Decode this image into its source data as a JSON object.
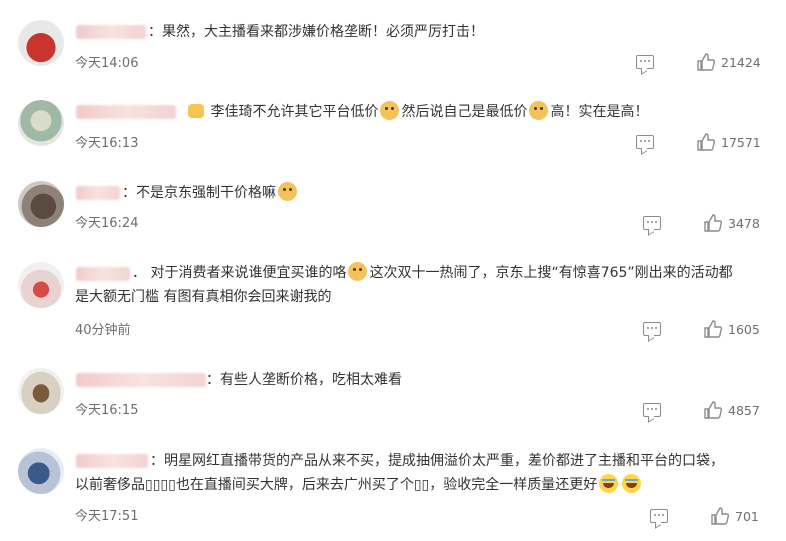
{
  "comments": [
    {
      "separator": "：",
      "segments": [
        "果然，大主播看来都涉嫌价格垄断！必须严厉打击！"
      ],
      "time": "今天14:06",
      "likes": "21424"
    },
    {
      "separator": "",
      "segments": [
        "李佳琦不允许其它平台低价",
        "然后说自己是最低价",
        "高！实在是高！"
      ],
      "time": "今天16:13",
      "likes": "17571"
    },
    {
      "separator": "：",
      "segments": [
        "不是京东强制干价格嘛"
      ],
      "time": "今天16:24",
      "likes": "3478"
    },
    {
      "separator": "．",
      "segments": [
        "对于消费者来说谁便宜买谁的咯",
        "这次双十一热闹了，京东上搜“有惊喜765”刚出来的活动都"
      ],
      "line2": "是大额无门槛 有图有真相你会回来谢我的",
      "time": "40分钟前",
      "likes": "1605"
    },
    {
      "separator": "：",
      "segments": [
        "有些人垄断价格，吃相太难看"
      ],
      "time": "今天16:15",
      "likes": "4857"
    },
    {
      "separator": "：",
      "segments": [
        "明星网红直播带货的产品从来不买，提成抽佣溢价太严重，差价都进了主播和平台的口袋，"
      ],
      "line2": "以前奢侈品▯▯▯▯也在直播间买大牌，后来去广州买了个▯▯，验收完全一样质量还更好",
      "time": "今天17:51",
      "likes": "701"
    }
  ],
  "icons": {
    "reply": "comment-icon",
    "like": "thumbs-up-icon"
  },
  "colors": {
    "text": "#333333",
    "meta": "#6f6f6f",
    "icon": "#8c8c8c"
  }
}
